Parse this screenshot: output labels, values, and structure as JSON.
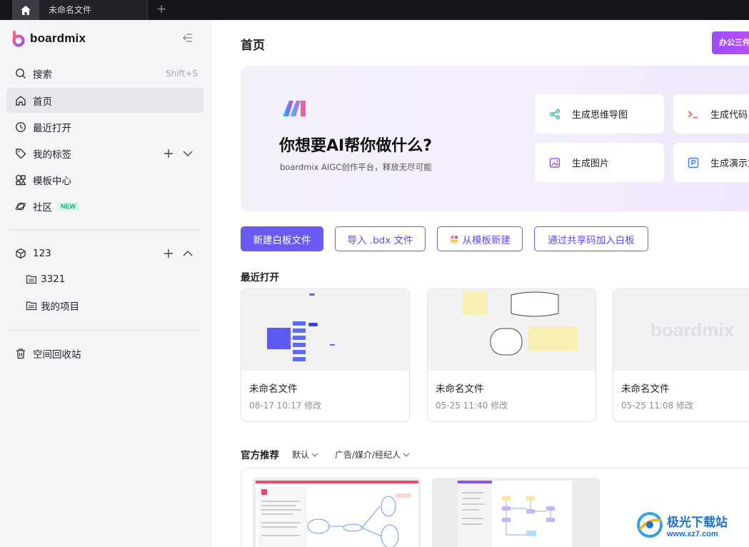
{
  "titlebar": {
    "tab_label": "未命名文件",
    "new_tab": "+"
  },
  "sidebar": {
    "brand": "boardmix",
    "search": {
      "label": "搜索",
      "shortcut": "Shift+S"
    },
    "items": [
      {
        "label": "首页",
        "icon": "home-icon",
        "active": true
      },
      {
        "label": "最近打开",
        "icon": "clock-icon"
      },
      {
        "label": "我的标签",
        "icon": "tag-icon"
      },
      {
        "label": "模板中心",
        "icon": "template-icon"
      },
      {
        "label": "社区",
        "icon": "planet-icon",
        "badge": "NEW"
      }
    ],
    "space": {
      "name": "123",
      "folders": [
        {
          "label": "3321",
          "icon": "folder-icon"
        },
        {
          "label": "我的项目",
          "icon": "folder-icon"
        }
      ]
    },
    "trash": "空间回收站"
  },
  "main": {
    "title": "首页",
    "office_button": "办公三件",
    "ai": {
      "heading": "你想要AI帮你做什么?",
      "subtitle": "boardmix AIGC创作平台，释放无尽可能",
      "cards": [
        {
          "label": "生成思维导图",
          "icon": "mindmap-icon",
          "color": "#1fb8a6"
        },
        {
          "label": "生成代码",
          "icon": "code-icon",
          "color": "#f0533f"
        },
        {
          "label": "生成图片",
          "icon": "image-icon",
          "color": "#8a52f0"
        },
        {
          "label": "生成演示文",
          "icon": "presentation-icon",
          "color": "#2f80f0"
        }
      ]
    },
    "actions": {
      "new_whiteboard": "新建白板文件",
      "import_bdx": "导入 .bdx 文件",
      "from_template": "从模板新建",
      "join_by_code": "通过共享码加入白板"
    },
    "recent": {
      "title": "最近打开",
      "files": [
        {
          "name": "未命名文件",
          "time": "08-17 10:17 修改"
        },
        {
          "name": "未命名文件",
          "time": "05-25 11:40 修改"
        },
        {
          "name": "未命名文件",
          "time": "05-25 11:08 修改",
          "placeholder_logo": "boardmix"
        }
      ]
    },
    "recommend": {
      "title": "官方推荐",
      "filter_default": "默认",
      "filter_category": "广告/媒介/经纪人"
    }
  },
  "watermark": {
    "cn": "极光下载站",
    "url": "www.xz7.com"
  },
  "colors": {
    "accent": "#6b5bf2",
    "sidebar_bg": "#f5f5f7",
    "titlebar_bg": "#16161b"
  }
}
